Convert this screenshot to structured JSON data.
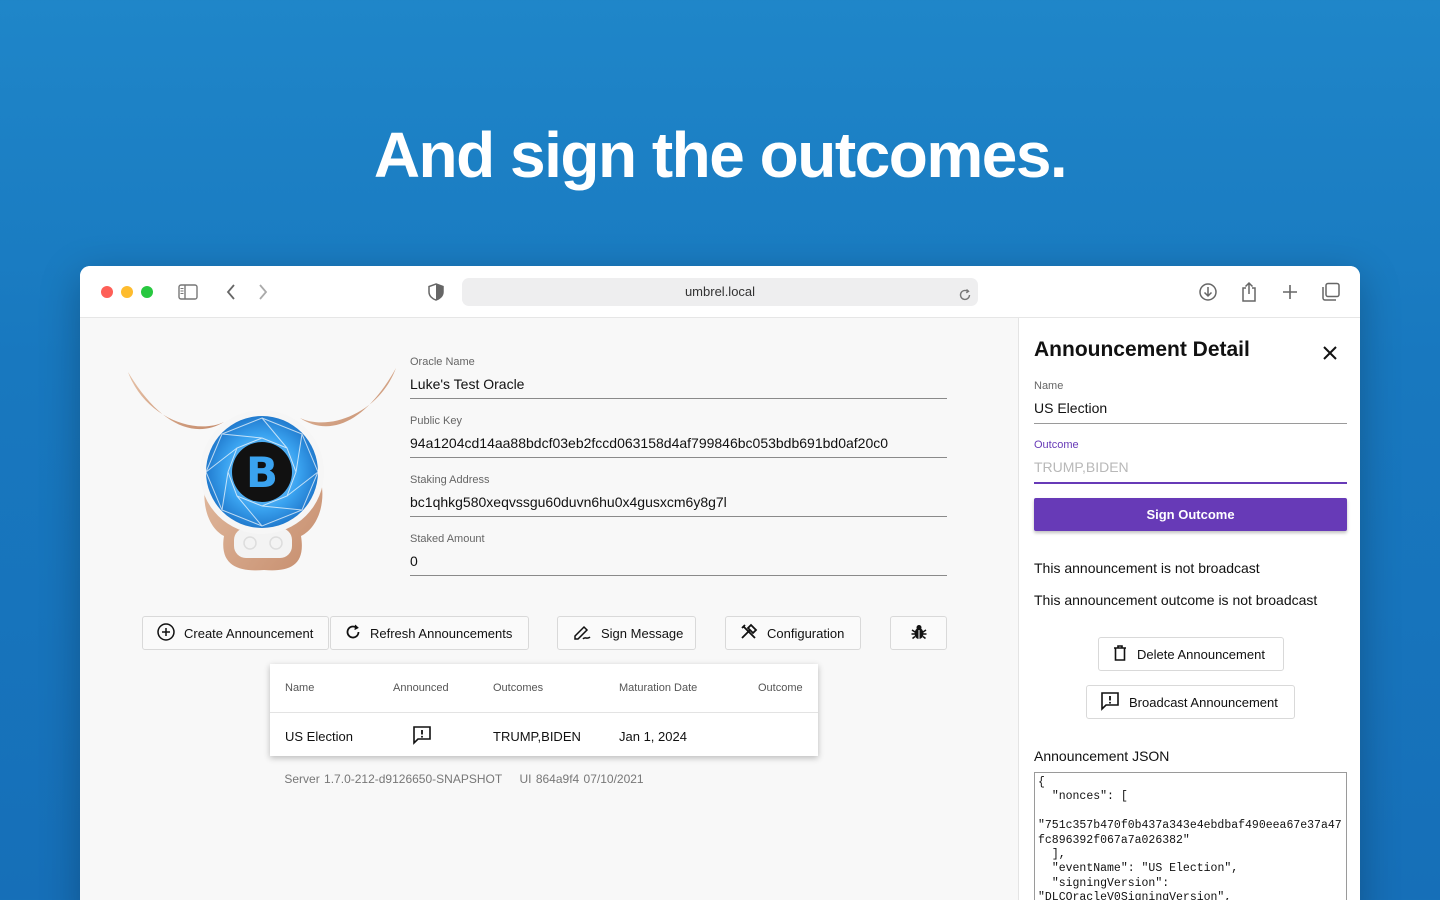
{
  "headline": "And sign the outcomes.",
  "browser": {
    "url": "umbrel.local",
    "icons": [
      "sidebar-icon",
      "back-icon",
      "forward-icon",
      "shield-icon",
      "reload-icon",
      "download-icon",
      "share-icon",
      "new-tab-icon",
      "tabs-icon"
    ]
  },
  "oracle": {
    "name_label": "Oracle Name",
    "name": "Luke's Test Oracle",
    "pubkey_label": "Public Key",
    "pubkey": "94a1204cd14aa88bdcf03eb2fccd063158d4af799846bc053bdb691bd0af20c0",
    "staking_label": "Staking Address",
    "staking_address": "bc1qhkg580xeqvssgu60duvn6hu0x4gusxcm6y8g7l",
    "staked_label": "Staked Amount",
    "staked_amount": "0"
  },
  "actions": {
    "create": "Create Announcement",
    "refresh": "Refresh Announcements",
    "sign_message": "Sign Message",
    "configuration": "Configuration"
  },
  "table": {
    "headers": [
      "Name",
      "Announced",
      "Outcomes",
      "Maturation Date",
      "Outcome"
    ],
    "rows": [
      {
        "name": "US Election",
        "outcomes": "TRUMP,BIDEN",
        "maturation": "Jan 1, 2024",
        "outcome": ""
      }
    ]
  },
  "footer": {
    "server": "Server 1.7.0-212-d9126650-SNAPSHOT",
    "ui": "UI 864a9f4 07/10/2021"
  },
  "detail": {
    "title": "Announcement Detail",
    "name_label": "Name",
    "name": "US Election",
    "outcome_label": "Outcome",
    "outcome_placeholder": "TRUMP,BIDEN",
    "sign_button": "Sign Outcome",
    "status1": "This announcement is not broadcast",
    "status2": "This announcement outcome is not broadcast",
    "delete_button": "Delete Announcement",
    "broadcast_button": "Broadcast Announcement",
    "json_label": "Announcement JSON",
    "json_text": "{\n  \"nonces\": [\n\n\"751c357b470f0b437a343e4ebdbaf490eea67e37a47fc896392f067a7a026382\"\n  ],\n  \"eventName\": \"US Election\",\n  \"signingVersion\":\n\"DLCOracleV0SigningVersion\","
  },
  "colors": {
    "background": "#1a7cc2",
    "accent": "#673ab7"
  }
}
